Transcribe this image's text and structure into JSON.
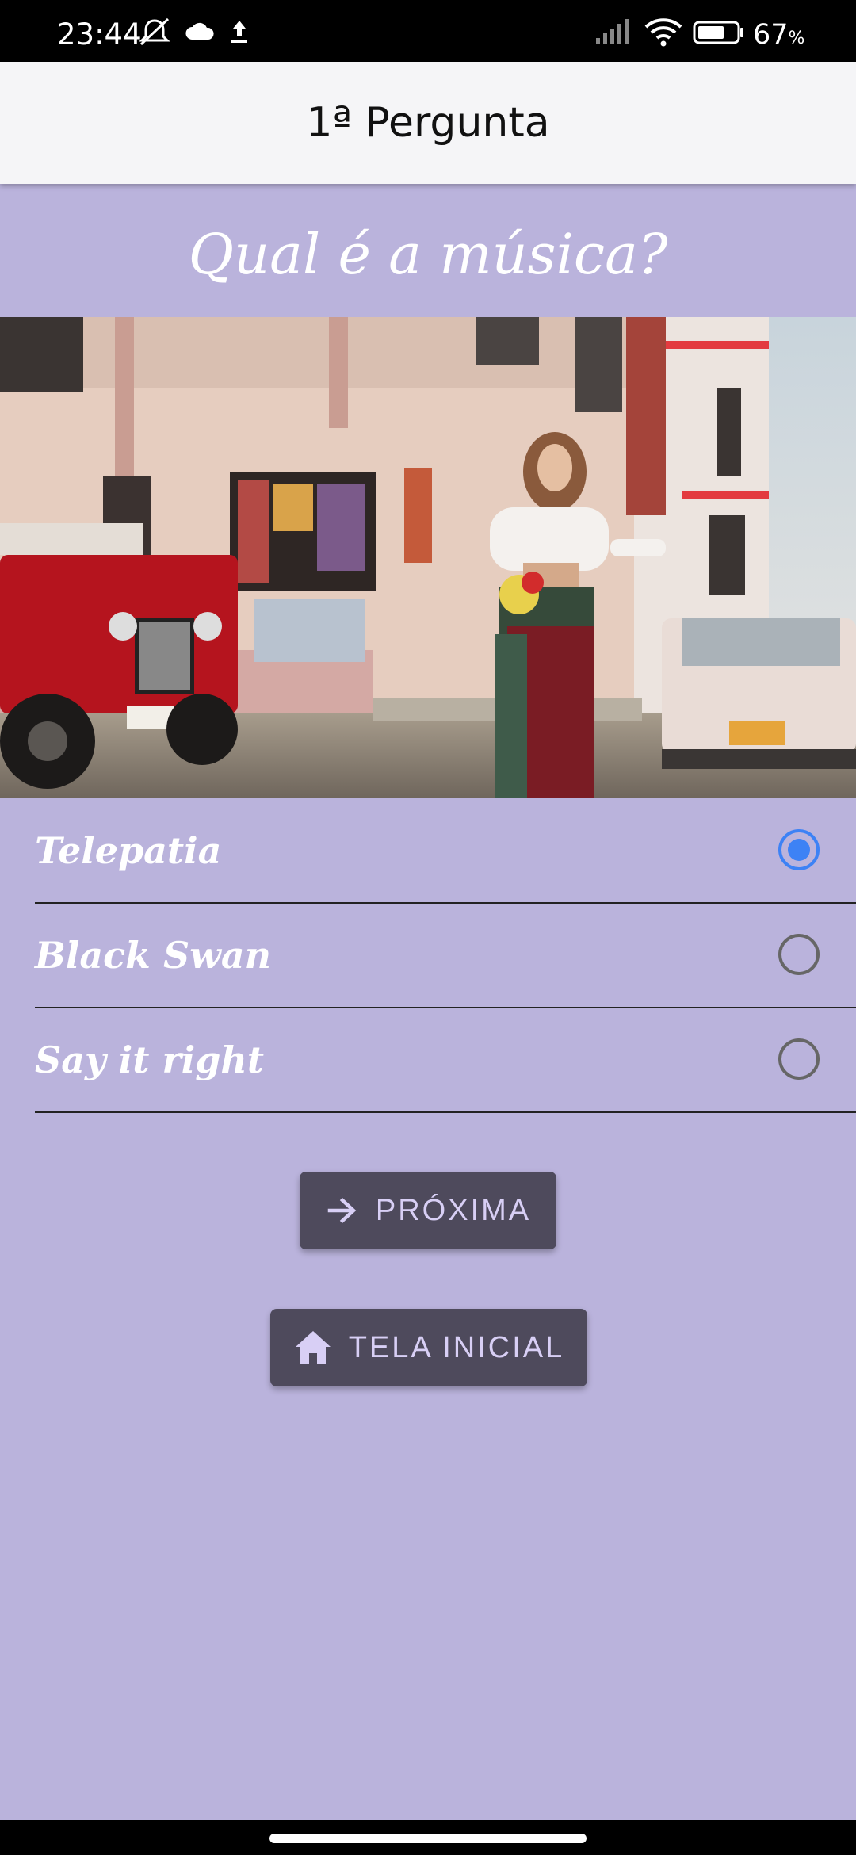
{
  "status_bar": {
    "time": "23:44",
    "battery_percent": "67",
    "battery_unit": "%",
    "icons": [
      "mute-alarm-icon",
      "cloud-icon",
      "upload-icon",
      "signal-icon",
      "wifi-icon",
      "battery-icon"
    ]
  },
  "app_bar": {
    "title": "1ª Pergunta"
  },
  "question": {
    "text": "Qual é a música?"
  },
  "media": {
    "description_icon": "music-video-still-image"
  },
  "options": [
    {
      "label": "Telepatia",
      "selected": true
    },
    {
      "label": "Black Swan",
      "selected": false
    },
    {
      "label": "Say it right",
      "selected": false
    }
  ],
  "buttons": {
    "next_label": "PRÓXIMA",
    "next_icon": "arrow-right-icon",
    "home_label": "TELA INICIAL",
    "home_icon": "home-icon"
  },
  "colors": {
    "background": "#bab3dc",
    "radio_selected": "#3d82f5",
    "button_bg": "#4e4a5c",
    "button_text": "#d8cff5"
  }
}
